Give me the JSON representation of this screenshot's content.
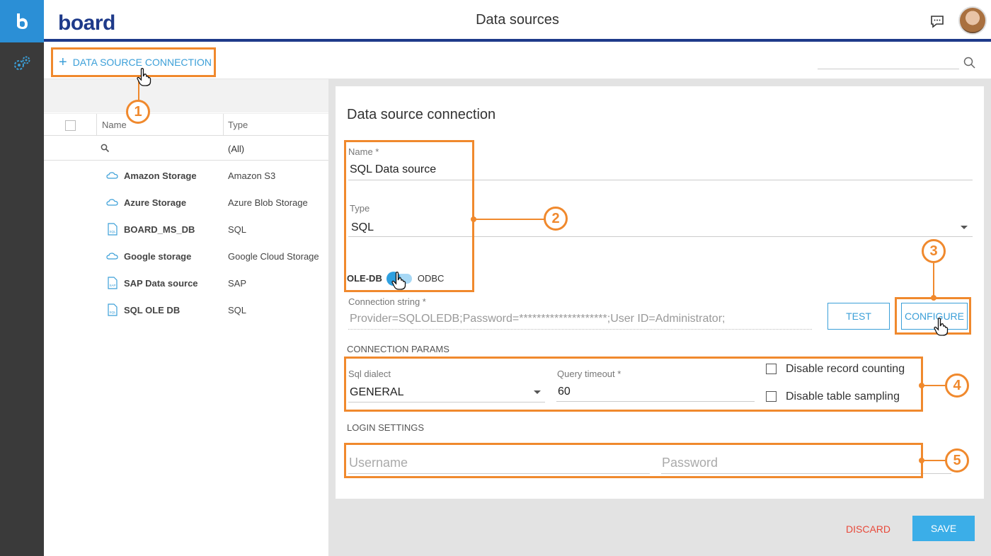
{
  "app": {
    "brand": "board",
    "title": "Data sources"
  },
  "toolbar": {
    "add_label": "DATA SOURCE CONNECTION"
  },
  "list": {
    "columns": {
      "name": "Name",
      "type": "Type"
    },
    "filter_all": "(All)",
    "rows": [
      {
        "name": "Amazon Storage",
        "type": "Amazon S3",
        "icon": "cloud-icon"
      },
      {
        "name": "Azure Storage",
        "type": "Azure Blob Storage",
        "icon": "cloud-icon"
      },
      {
        "name": "BOARD_MS_DB",
        "type": "SQL",
        "icon": "sql-file-icon"
      },
      {
        "name": "Google storage",
        "type": "Google Cloud Storage",
        "icon": "cloud-icon"
      },
      {
        "name": "SAP Data source",
        "type": "SAP",
        "icon": "sap-file-icon"
      },
      {
        "name": "SQL OLE DB",
        "type": "SQL",
        "icon": "sql-file-icon"
      }
    ]
  },
  "form": {
    "title": "Data source connection",
    "name_label": "Name *",
    "name_value": "SQL Data source",
    "type_label": "Type",
    "type_value": "SQL",
    "toggle_left": "OLE-DB",
    "toggle_right": "ODBC",
    "conn_label": "Connection string *",
    "conn_value": "Provider=SQLOLEDB;Password=********************;User ID=Administrator;",
    "test_label": "TEST",
    "configure_label": "CONFIGURE",
    "params_title": "CONNECTION PARAMS",
    "dialect_label": "Sql dialect",
    "dialect_value": "GENERAL",
    "timeout_label": "Query timeout *",
    "timeout_value": "60",
    "disable_counting": "Disable record counting",
    "disable_sampling": "Disable table sampling",
    "login_title": "LOGIN SETTINGS",
    "username_placeholder": "Username",
    "password_placeholder": "Password",
    "discard_label": "DISCARD",
    "save_label": "SAVE"
  },
  "callouts": [
    "1",
    "2",
    "3",
    "4",
    "5"
  ],
  "colors": {
    "accent": "#3b9fd8",
    "highlight": "#f0892d",
    "header_line": "#1e3a8a",
    "danger": "#e8493a"
  }
}
